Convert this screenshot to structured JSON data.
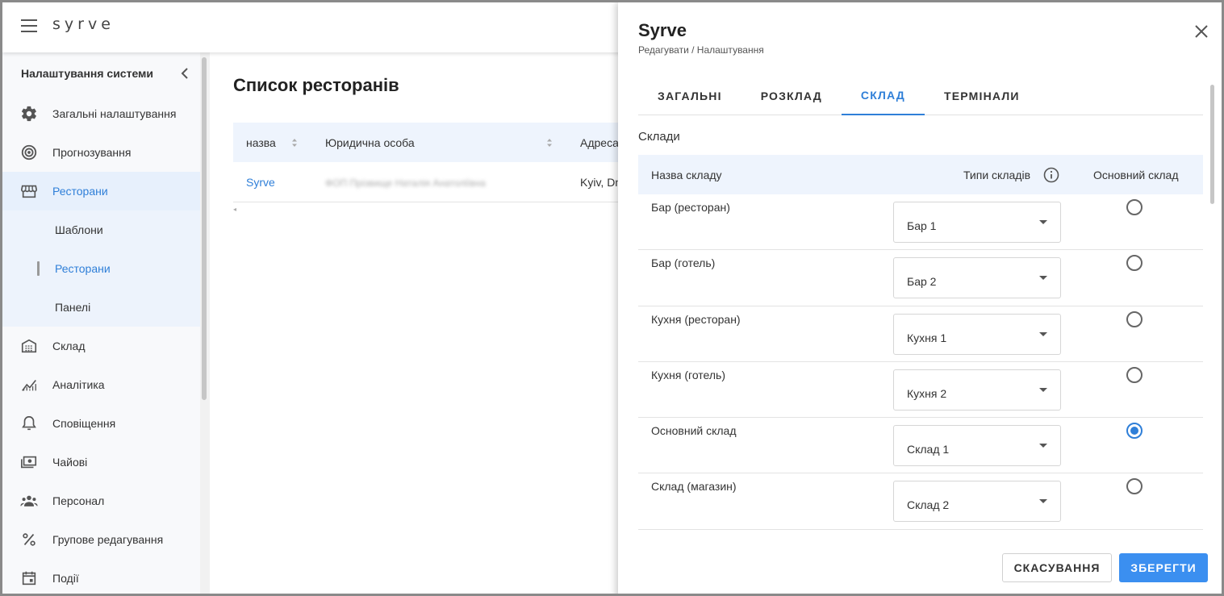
{
  "app": {
    "logo": "syrve"
  },
  "sidebar": {
    "header": "Налаштування системи",
    "items": [
      {
        "label": "Загальні налаштування",
        "icon": "gear-icon"
      },
      {
        "label": "Прогнозування",
        "icon": "target-icon"
      },
      {
        "label": "Ресторани",
        "icon": "store-icon",
        "active": true
      },
      {
        "label": "Склад",
        "icon": "warehouse-icon"
      },
      {
        "label": "Аналітика",
        "icon": "analytics-icon"
      },
      {
        "label": "Сповіщення",
        "icon": "bell-icon"
      },
      {
        "label": "Чайові",
        "icon": "money-icon"
      },
      {
        "label": "Персонал",
        "icon": "people-icon"
      },
      {
        "label": "Групове редагування",
        "icon": "percent-icon"
      },
      {
        "label": "Події",
        "icon": "calendar-icon"
      }
    ],
    "subitems": [
      {
        "label": "Шаблони"
      },
      {
        "label": "Ресторани",
        "active": true
      },
      {
        "label": "Панелі"
      }
    ]
  },
  "main": {
    "title": "Список ресторанів",
    "columns": [
      "назва",
      "Юридична особа",
      "Адреса"
    ],
    "rows": [
      {
        "name": "Syrve",
        "legal": "ФОП Прізвище Наталія Анатоліївна",
        "address": "Kyiv, Dnipro"
      }
    ]
  },
  "drawer": {
    "title": "Syrve",
    "breadcrumb": "Редагувати / Налаштування",
    "tabs": [
      "ЗАГАЛЬНІ",
      "РОЗКЛАД",
      "СКЛАД",
      "ТЕРМІНАЛИ"
    ],
    "active_tab": "СКЛАД",
    "section": "Склади",
    "columns": {
      "name": "Назва складу",
      "types": "Типи складів",
      "main": "Основний склад"
    },
    "rows": [
      {
        "name": "Бар (ресторан)",
        "type": "Бар 1",
        "main": false
      },
      {
        "name": "Бар (готель)",
        "type": "Бар 2",
        "main": false
      },
      {
        "name": "Кухня (ресторан)",
        "type": "Кухня 1",
        "main": false
      },
      {
        "name": "Кухня (готель)",
        "type": "Кухня 2",
        "main": false
      },
      {
        "name": "Основний склад",
        "type": "Склад 1",
        "main": true
      },
      {
        "name": "Склад (магазин)",
        "type": "Склад 2",
        "main": false
      }
    ],
    "cancel_label": "СКАСУВАННЯ",
    "save_label": "ЗБЕРЕГТИ"
  },
  "colors": {
    "accent": "#2f7fd8",
    "button": "#3b8ff0",
    "table_header": "#eef4fd"
  }
}
